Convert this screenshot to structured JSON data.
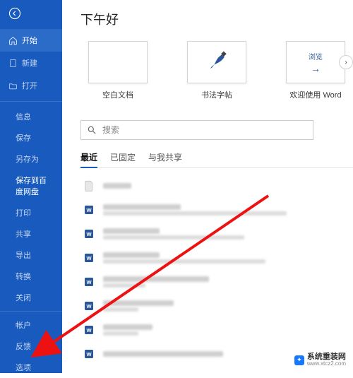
{
  "sidebar": {
    "start": "开始",
    "new": "新建",
    "open": "打开",
    "info": "信息",
    "save": "保存",
    "saveas": "另存为",
    "savecloud": "保存到百度网盘",
    "print": "打印",
    "share": "共享",
    "export": "导出",
    "transform": "转换",
    "close": "关闭",
    "account": "帐户",
    "feedback": "反馈",
    "options": "选项"
  },
  "main": {
    "greeting": "下午好",
    "templates": {
      "blank": "空白文档",
      "calligraphy": "书法字帖",
      "welcome": "欢迎使用 Word",
      "welcome_badge": "浏览"
    },
    "search_placeholder": "搜索",
    "tabs": {
      "recent": "最近",
      "pinned": "已固定",
      "shared": "与我共享"
    }
  },
  "watermark": "系统重装网",
  "watermark_url": "www.xtcz2.com"
}
